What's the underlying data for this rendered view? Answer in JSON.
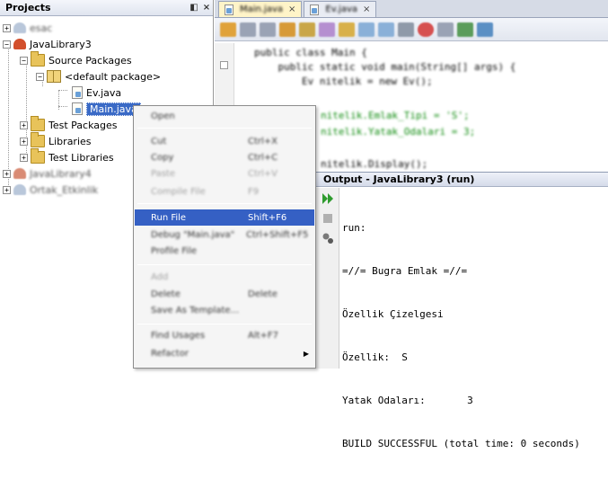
{
  "projects": {
    "title": "Projects",
    "controls": [
      "◧",
      "×"
    ],
    "items": [
      {
        "label": "esac",
        "blurred": true
      },
      {
        "label": "JavaLibrary3",
        "blurred": false
      },
      {
        "label": "Source Packages",
        "blurred": false
      },
      {
        "label": "<default package>",
        "blurred": false
      },
      {
        "label": "Ev.java",
        "blurred": false
      },
      {
        "label": "Main.java",
        "blurred": false
      },
      {
        "label": "Test Packages",
        "blurred": false
      },
      {
        "label": "Libraries",
        "blurred": false
      },
      {
        "label": "Test Libraries",
        "blurred": false
      },
      {
        "label": "JavaLibrary4",
        "blurred": true
      },
      {
        "label": "Ortak_Etkinlik",
        "blurred": true
      }
    ]
  },
  "editor": {
    "tabs": [
      {
        "label": "Main.java",
        "close": "×"
      },
      {
        "label": "Ev.java",
        "close": "×"
      }
    ],
    "code": [
      "public class Main {",
      "    public static void main(String[] args) {",
      "        Ev nitelik = new Ev();",
      "nitelik.Emlak_Tipi = 'S';",
      "nitelik.Yatak_Odalari = 3;",
      "nitelik.Display();"
    ]
  },
  "output": {
    "title": "Output - JavaLibrary3 (run)",
    "lines": [
      "run:",
      "=//= Bugra Emlak =//=",
      "Özellik Çizelgesi",
      "Özellik:  S",
      "Yatak Odaları:       3",
      "BUILD SUCCESSFUL (total time: 0 seconds)"
    ]
  },
  "context_menu": {
    "items": [
      {
        "label": "Open",
        "shortcut": ""
      },
      {
        "label": "Cut",
        "shortcut": "Ctrl+X"
      },
      {
        "label": "Copy",
        "shortcut": "Ctrl+C"
      },
      {
        "label": "Paste",
        "shortcut": "Ctrl+V"
      },
      {
        "label": "Compile File",
        "shortcut": "F9"
      },
      {
        "label": "Run File",
        "shortcut": "Shift+F6"
      },
      {
        "label": "Debug \"Main.java\"",
        "shortcut": "Ctrl+Shift+F5"
      },
      {
        "label": "Profile File",
        "shortcut": ""
      },
      {
        "label": "Add",
        "shortcut": ""
      },
      {
        "label": "Delete",
        "shortcut": "Delete"
      },
      {
        "label": "Save As Template...",
        "shortcut": ""
      },
      {
        "label": "Find Usages",
        "shortcut": "Alt+F7"
      },
      {
        "label": "Refactor",
        "shortcut": ""
      }
    ],
    "highlighted": "Run File",
    "submenu_arrow": "▶"
  },
  "colors": {
    "selection": "#3560c4",
    "run_icon": "#2e9b2e",
    "stop_icon": "#c92b2b"
  }
}
